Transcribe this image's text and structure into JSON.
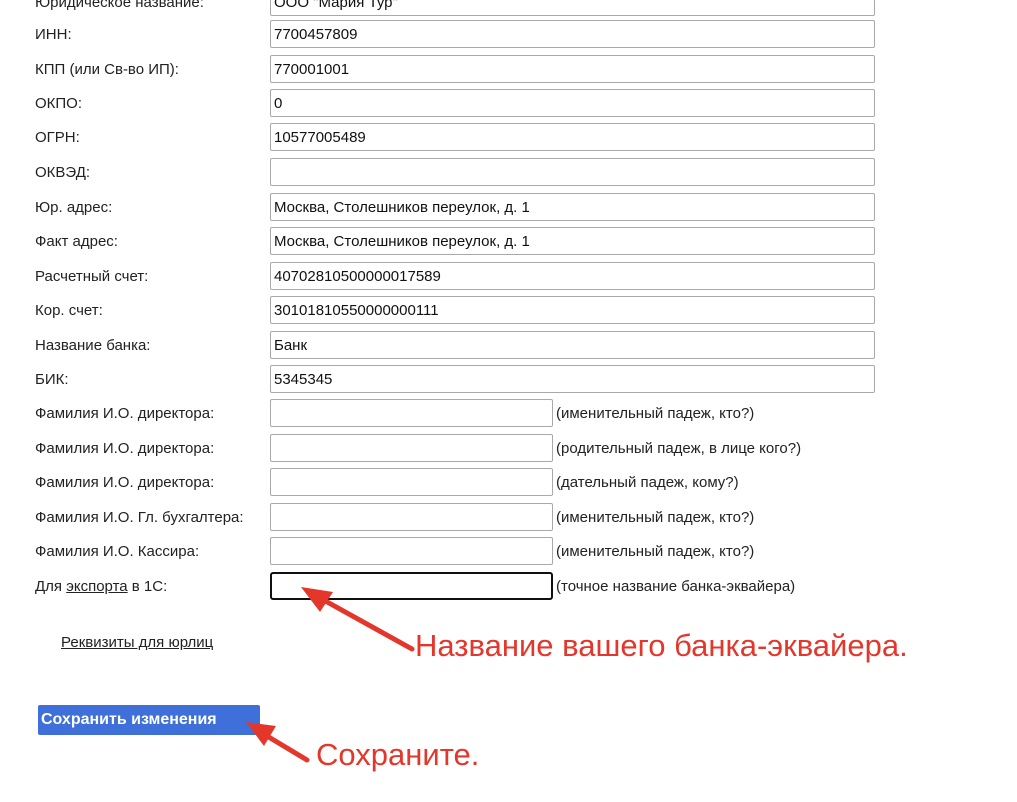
{
  "form": {
    "rows": [
      {
        "label": "Юридическое название:",
        "value": "ООО \"Мария Тур\""
      },
      {
        "label": "ИНН:",
        "value": "7700457809"
      },
      {
        "label": "КПП (или Св-во ИП):",
        "value": "770001001"
      },
      {
        "label": "ОКПО:",
        "value": "0"
      },
      {
        "label": "ОГРН:",
        "value": "10577005489"
      },
      {
        "label": "ОКВЭД:",
        "value": ""
      },
      {
        "label": "Юр. адрес:",
        "value": "Москва, Столешников переулок, д. 1"
      },
      {
        "label": "Факт адрес:",
        "value": "Москва, Столешников переулок, д. 1"
      },
      {
        "label": "Расчетный счет:",
        "value": "40702810500000017589"
      },
      {
        "label": "Кор. счет:",
        "value": "30101810550000000111"
      },
      {
        "label": "Название банка:",
        "value": "Банк"
      },
      {
        "label": "БИК:",
        "value": "5345345"
      },
      {
        "label": "Фамилия И.О. директора:",
        "value": "",
        "hint": "(именительный падеж, кто?)"
      },
      {
        "label": "Фамилия И.О. директора:",
        "value": "",
        "hint": "(родительный падеж, в лице кого?)"
      },
      {
        "label": "Фамилия И.О. директора:",
        "value": "",
        "hint": "(дательный падеж, кому?)"
      },
      {
        "label": "Фамилия И.О. Гл. бухгалтера:",
        "value": "",
        "hint": "(именительный падеж, кто?)"
      },
      {
        "label": "Фамилия И.О. Кассира:",
        "value": "",
        "hint": "(именительный падеж, кто?)"
      }
    ],
    "export_row": {
      "label_prefix": "Для ",
      "label_link": "экспорта",
      "label_suffix": " в 1С:",
      "value": "",
      "hint": "(точное название банка-эквайера)"
    },
    "legal_link": "Реквизиты для юрлиц",
    "save_label": "Сохранить изменения"
  },
  "annotations": {
    "bank_note": "Название вашего банка-эквайера.",
    "save_note": "Сохраните.",
    "color": "#e3372c"
  }
}
